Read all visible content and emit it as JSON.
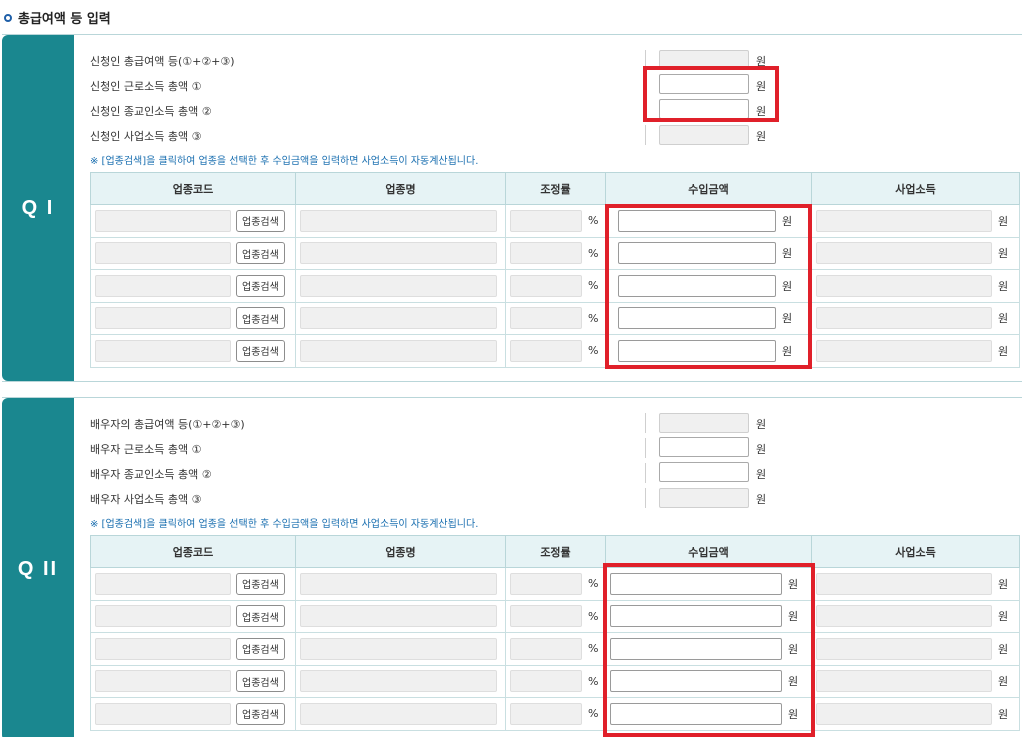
{
  "page": {
    "title": "총급여액 등 입력"
  },
  "won": "원",
  "percent": "%",
  "note": "※ [업종검색]을 클릭하여 업종을 선택한 후 수입금액을 입력하면 사업소득이 자동계산됩니다.",
  "columns": [
    "업종코드",
    "업종명",
    "조정률",
    "수입금액",
    "사업소득"
  ],
  "search_button": "업종검색",
  "panel1": {
    "label": "Q I",
    "rows": [
      {
        "label": "신청인 총급여액 등(①+②+③)"
      },
      {
        "label": "신청인 근로소득 총액 ①"
      },
      {
        "label": "신청인 종교인소득 총액 ②"
      },
      {
        "label": "신청인 사업소득 총액 ③"
      }
    ]
  },
  "panel2": {
    "label": "Q II",
    "rows": [
      {
        "label": "배우자의 총급여액 등(①+②+③)"
      },
      {
        "label": "배우자 근로소득 총액 ①"
      },
      {
        "label": "배우자 종교인소득 총액 ②"
      },
      {
        "label": "배우자 사업소득 총액 ③"
      }
    ]
  },
  "colors": {
    "accent": "#1a878f",
    "highlight": "#e0202a",
    "header_bg": "#e6f3f5"
  }
}
